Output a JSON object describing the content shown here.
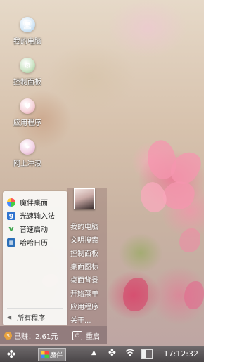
{
  "desktop": {
    "icons": [
      {
        "label": "我的电脑",
        "icon": "computer-icon"
      },
      {
        "label": "控制面板",
        "icon": "control-panel-icon"
      },
      {
        "label": "应用程序",
        "icon": "applications-icon"
      },
      {
        "label": "网上冲浪",
        "icon": "browser-icon"
      }
    ]
  },
  "start_menu": {
    "left_items": [
      {
        "label": "魔伴桌面",
        "icon": "mobo-desktop-icon",
        "color": "#4c9be8"
      },
      {
        "label": "光速输入法",
        "icon": "input-method-icon",
        "color": "#2f74d0"
      },
      {
        "label": "音速启动",
        "icon": "quick-launch-icon",
        "color": "#3aa24a"
      },
      {
        "label": "哈哈日历",
        "icon": "calendar-icon",
        "color": "#2c6fb8"
      }
    ],
    "all_programs": {
      "label": "所有程序",
      "icon": "triangle-left-icon"
    },
    "right_links": [
      "我的电脑",
      "文明搜索",
      "控制面板",
      "桌面图标",
      "桌面背景",
      "开始菜单",
      "应用程序",
      "关于..."
    ],
    "status": {
      "text": "已赚：2.61元",
      "icon": "coin-icon"
    },
    "restart": {
      "label": "重启",
      "icon": "power-icon"
    }
  },
  "taskbar": {
    "start_icon": "clover-icon",
    "active_task": {
      "label": "魔伴",
      "icon": "mobo-app-icon"
    },
    "tray": {
      "up": "▲",
      "clock": "17:12:32"
    }
  }
}
